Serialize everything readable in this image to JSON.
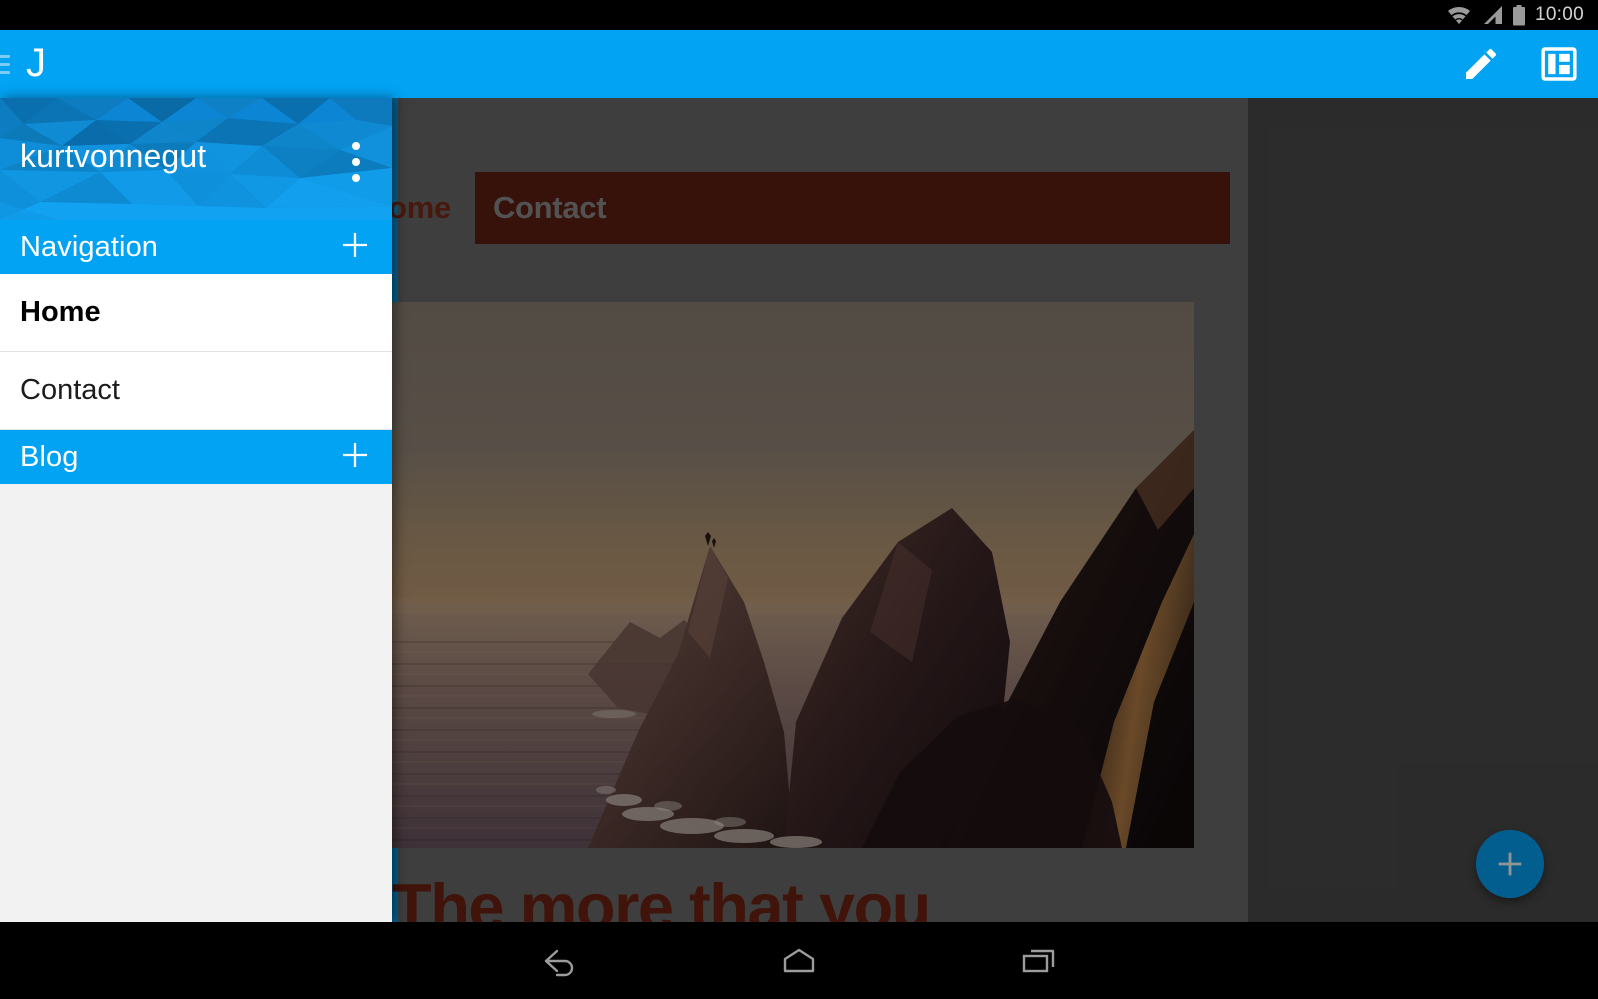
{
  "status_bar": {
    "time": "10:00",
    "icons": [
      "wifi-icon",
      "cellular-signal-icon",
      "battery-icon"
    ]
  },
  "app_bar": {
    "menu_icon": "hamburger-menu-icon",
    "brand": "J",
    "actions": [
      {
        "name": "edit-pencil-icon",
        "label": "Edit"
      },
      {
        "name": "layout-view-icon",
        "label": "Layout"
      }
    ]
  },
  "drawer": {
    "account_name": "kurtvonnegut",
    "overflow_icon": "more-vertical-icon",
    "sections": [
      {
        "title": "Navigation",
        "add_icon": "plus-icon"
      },
      {
        "title": "Blog",
        "add_icon": "plus-icon"
      }
    ],
    "nav_items": [
      {
        "label": "Home",
        "selected": true
      },
      {
        "label": "Contact",
        "selected": false
      }
    ]
  },
  "preview": {
    "site_nav": [
      {
        "label": "Home",
        "active": false
      },
      {
        "label": "Contact",
        "active": true
      }
    ],
    "headline": "The more that you",
    "hero_alt": "coastal-cliffs-sunset-photo"
  },
  "fab": {
    "icon": "plus-icon",
    "label": "Add"
  },
  "navigation_bar": {
    "buttons": [
      {
        "name": "back-button",
        "icon": "back-arrow-icon"
      },
      {
        "name": "home-button",
        "icon": "home-icon"
      },
      {
        "name": "recents-button",
        "icon": "recents-icon"
      }
    ]
  },
  "colors": {
    "accent_blue": "#03a3f4",
    "drawer_header_blue": "#0e90e0",
    "site_dark_red": "#5f2013",
    "site_text_red": "#7d2a18",
    "scrim": "rgba(0,0,0,0.42)"
  }
}
